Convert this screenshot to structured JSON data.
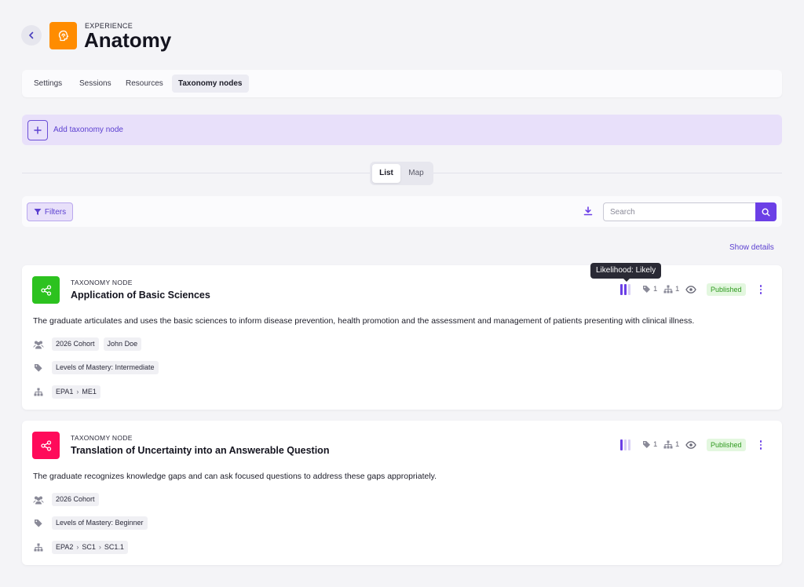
{
  "header": {
    "eyebrow": "EXPERIENCE",
    "title": "Anatomy",
    "icon": "brain-icon",
    "icon_color": "#ff8c00"
  },
  "tabs": [
    {
      "label": "Settings",
      "active": false
    },
    {
      "label": "Sessions",
      "active": false
    },
    {
      "label": "Resources",
      "active": false
    },
    {
      "label": "Taxonomy nodes",
      "active": true
    }
  ],
  "add_node": {
    "label": "Add taxonomy node",
    "icon": "plus-icon"
  },
  "view_toggle": {
    "list": "List",
    "map": "Map",
    "selected": "List"
  },
  "filter_bar": {
    "filters_label": "Filters",
    "search_placeholder": "Search",
    "search_value": ""
  },
  "show_details": "Show details",
  "tooltip": "Likelihood: Likely",
  "accent_color": "#6b3fe6",
  "nodes": [
    {
      "eyebrow": "TAXONOMY NODE",
      "title": "Application of Basic Sciences",
      "icon_color": "#2cc21f",
      "likelihood_level": 2,
      "likelihood_max": 3,
      "tag_count": "1",
      "hierarchy_count": "1",
      "status": "Published",
      "description": "The graduate articulates and uses the basic sciences to inform disease prevention, health promotion and the assessment and management of patients presenting with clinical illness.",
      "groups": [
        "2026 Cohort",
        "John Doe"
      ],
      "tags": [
        "Levels of Mastery: Intermediate"
      ],
      "path": [
        "EPA1",
        "ME1"
      ]
    },
    {
      "eyebrow": "TAXONOMY NODE",
      "title": "Translation of Uncertainty into an Answerable Question",
      "icon_color": "#ff0a5a",
      "likelihood_level": 1,
      "likelihood_max": 3,
      "tag_count": "1",
      "hierarchy_count": "1",
      "status": "Published",
      "description": "The graduate recognizes knowledge gaps and can ask focused questions to address these gaps appropriately.",
      "groups": [
        "2026 Cohort"
      ],
      "tags": [
        "Levels of Mastery: Beginner"
      ],
      "path": [
        "EPA2",
        "SC1",
        "SC1.1"
      ]
    }
  ]
}
